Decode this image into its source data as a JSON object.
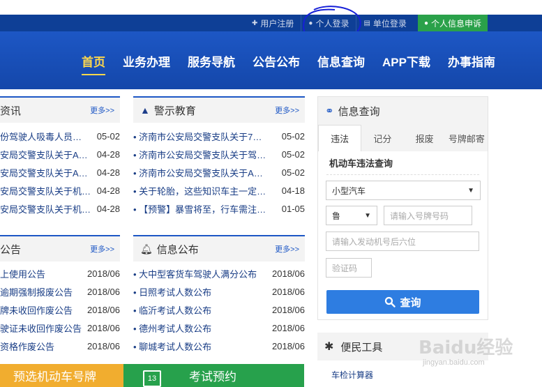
{
  "topbar": {
    "links": [
      {
        "icon": "plus",
        "label": "用户注册"
      },
      {
        "icon": "user",
        "label": "个人登录"
      },
      {
        "icon": "building",
        "label": "单位登录"
      },
      {
        "icon": "user",
        "label": "个人信息申诉"
      }
    ]
  },
  "nav": {
    "items": [
      "首页",
      "业务办理",
      "服务导航",
      "公告公布",
      "信息查询",
      "APP下载",
      "办事指南"
    ],
    "active_index": 0
  },
  "more_label": "更多>>",
  "news": {
    "title": "资讯",
    "items": [
      {
        "title": "份驾驶人吸毒人员…",
        "date": "05-02"
      },
      {
        "title": "安局交警支队关于A…",
        "date": "04-28"
      },
      {
        "title": "安局交警支队关于A…",
        "date": "04-28"
      },
      {
        "title": "安局交警支队关于机…",
        "date": "04-28"
      },
      {
        "title": "安局交警支队关于机…",
        "date": "04-28"
      }
    ]
  },
  "warning": {
    "title": "警示教育",
    "items": [
      {
        "title": "济南市公安局交警支队关于7…",
        "date": "05-02"
      },
      {
        "title": "济南市公安局交警支队关于驾…",
        "date": "05-02"
      },
      {
        "title": "济南市公安局交警支队关于A…",
        "date": "05-02"
      },
      {
        "title": "关于轮胎，这些知识车主一定…",
        "date": "04-18"
      },
      {
        "title": "【预警】暴雪将至，行车需注…",
        "date": "01-05"
      }
    ]
  },
  "notices": {
    "title": "公告",
    "items": [
      {
        "title": "上使用公告",
        "date": "2018/06"
      },
      {
        "title": "逾期强制报废公告",
        "date": "2018/06"
      },
      {
        "title": "牌未收回作废公告",
        "date": "2018/06"
      },
      {
        "title": "驶证未收回作废公告",
        "date": "2018/06"
      },
      {
        "title": "资格作废公告",
        "date": "2018/06"
      }
    ]
  },
  "info": {
    "title": "信息公布",
    "items": [
      {
        "title": "大中型客货车驾驶人满分公布",
        "date": "2018/06"
      },
      {
        "title": "日照考试人数公布",
        "date": "2018/06"
      },
      {
        "title": "临沂考试人数公布",
        "date": "2018/06"
      },
      {
        "title": "德州考试人数公布",
        "date": "2018/06"
      },
      {
        "title": "聊城考试人数公布",
        "date": "2018/06"
      }
    ]
  },
  "query": {
    "title": "信息查询",
    "tabs": [
      "违法",
      "记分",
      "报废",
      "号牌邮寄"
    ],
    "active_tab": 0,
    "subtitle": "机动车违法查询",
    "vehicle_type": "小型汽车",
    "province": "鲁",
    "plate_placeholder": "请输入号牌号码",
    "engine_placeholder": "请输入发动机号后六位",
    "captcha_placeholder": "验证码",
    "button_label": "查询"
  },
  "tools": {
    "title": "便民工具",
    "link": "车检计算器"
  },
  "banners": {
    "left": "预选机动车号牌",
    "right": "考试预约",
    "calendar_day": "13"
  },
  "watermark": {
    "text": "Baidu经验",
    "sub": "jingyan.baidu.com"
  },
  "colors": {
    "topbar": "#0e3f96",
    "nav": "#1d57c5",
    "active_nav": "#ffd84c",
    "query_button": "#2e7de1",
    "green_banner": "#27a14c",
    "yellow_banner": "#f1ad2f"
  }
}
